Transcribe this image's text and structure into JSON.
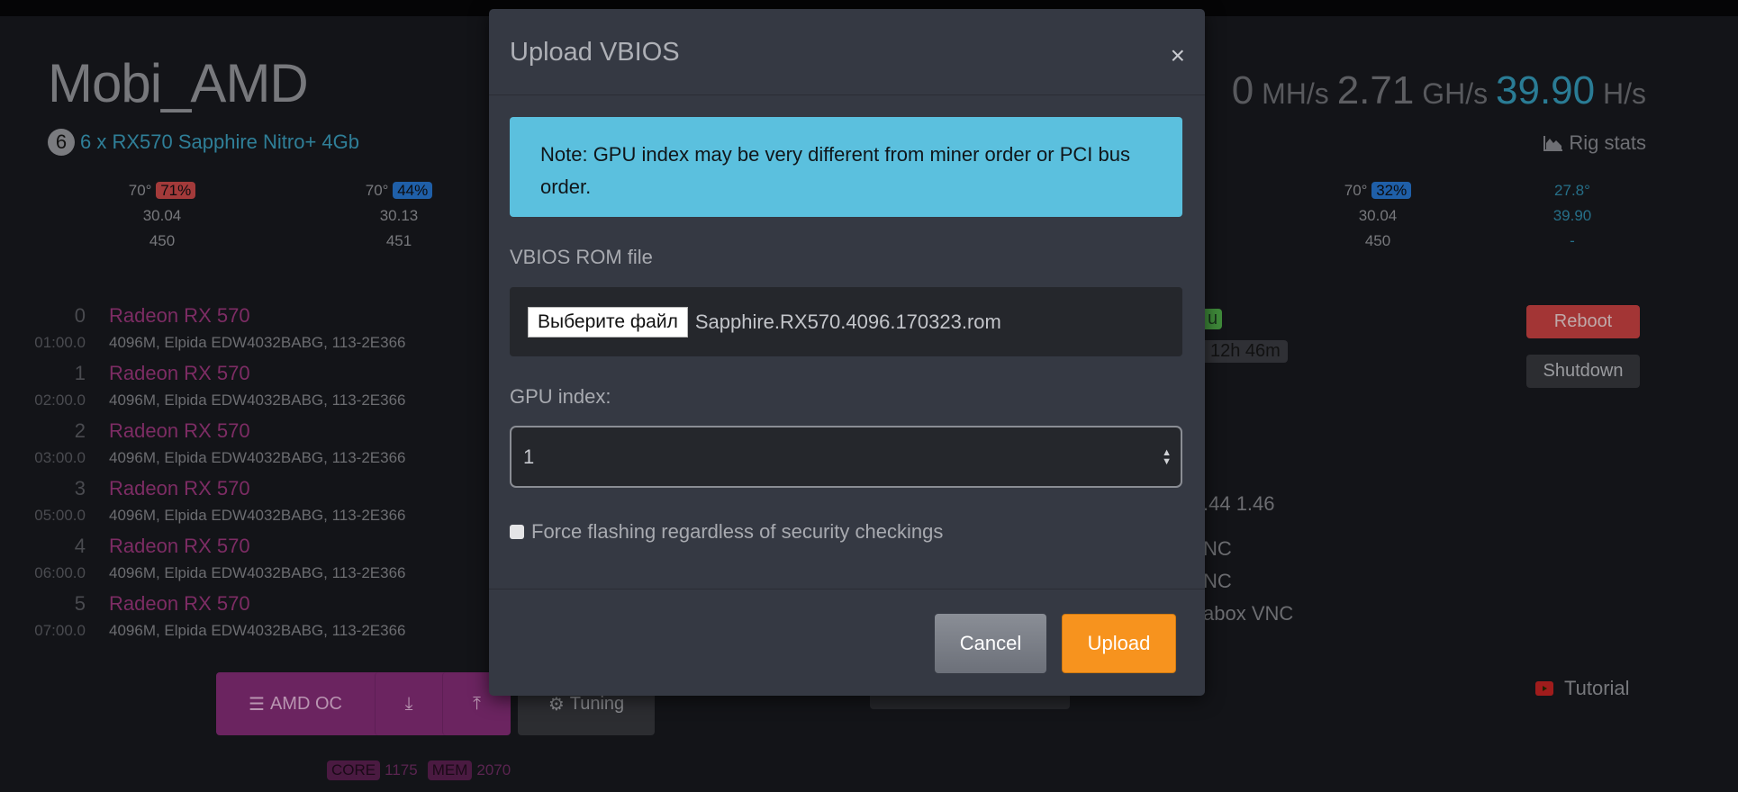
{
  "rig": {
    "name": "Mobi_AMD",
    "gpu_count": "6",
    "description": "6 x RX570 Sapphire Nitro+ 4Gb"
  },
  "hashrate": {
    "partial": "0",
    "unit1": "MH/s",
    "value2": "2.71",
    "unit2": "GH/s",
    "value3": "39.90",
    "unit3": "H/s"
  },
  "rig_stats_label": "Rig stats",
  "stats": [
    {
      "temp": "70°",
      "fan": "71%",
      "fan_color": "#a33a3a",
      "hash": "30.04",
      "power": "450"
    },
    {
      "temp": "70°",
      "fan": "44%",
      "fan_color": "#1f5fa8",
      "hash": "30.13",
      "power": "451"
    },
    {
      "temp": "70°",
      "fan": "32%",
      "fan_color": "#1f5fa8",
      "hash": "30.04",
      "power": "450"
    },
    {
      "temp": "27.8°",
      "hash": "39.90",
      "power": "-"
    }
  ],
  "gpus": [
    {
      "index": "0",
      "bus": "01:00.0",
      "name": "Radeon RX 570",
      "details": "4096M, Elpida EDW4032BABG, 113-2E366"
    },
    {
      "index": "1",
      "bus": "02:00.0",
      "name": "Radeon RX 570",
      "details": "4096M, Elpida EDW4032BABG, 113-2E366"
    },
    {
      "index": "2",
      "bus": "03:00.0",
      "name": "Radeon RX 570",
      "details": "4096M, Elpida EDW4032BABG, 113-2E366"
    },
    {
      "index": "3",
      "bus": "05:00.0",
      "name": "Radeon RX 570",
      "details": "4096M, Elpida EDW4032BABG, 113-2E366"
    },
    {
      "index": "4",
      "bus": "06:00.0",
      "name": "Radeon RX 570",
      "details": "4096M, Elpida EDW4032BABG, 113-2E366"
    },
    {
      "index": "5",
      "bus": "07:00.0",
      "name": "Radeon RX 570",
      "details": "4096M, Elpida EDW4032BABG, 113-2E366"
    }
  ],
  "right_fragments": {
    "badge": "u",
    "uptime": "12h 46m",
    "load": ".44 1.46",
    "vnc1": "NC",
    "vnc2": "NC",
    "vnc3": "abox  VNC"
  },
  "buttons": {
    "reboot": "Reboot",
    "shutdown": "Shutdown",
    "tutorial": "Tutorial",
    "amd_oc": "AMD OC",
    "tuning": "Tuning"
  },
  "oc": {
    "core_label": "CORE",
    "core": "1175",
    "mem_label": "MEM",
    "mem": "2070"
  },
  "modal": {
    "title": "Upload VBIOS",
    "note": "Note: GPU index may be very different from miner order or PCI bus order.",
    "file_label": "VBIOS ROM file",
    "file_button": "Выберите файл",
    "file_name": "Sapphire.RX570.4096.170323.rom",
    "gpu_index_label": "GPU index:",
    "gpu_index_value": "1",
    "force_label": "Force flashing regardless of security checkings",
    "force_checked": false,
    "cancel": "Cancel",
    "upload": "Upload"
  },
  "colors": {
    "accent": "#2f7f98",
    "upload": "#f7931e",
    "reboot": "#a33535",
    "amd": "#6e2660",
    "note": "#5bc0de"
  }
}
